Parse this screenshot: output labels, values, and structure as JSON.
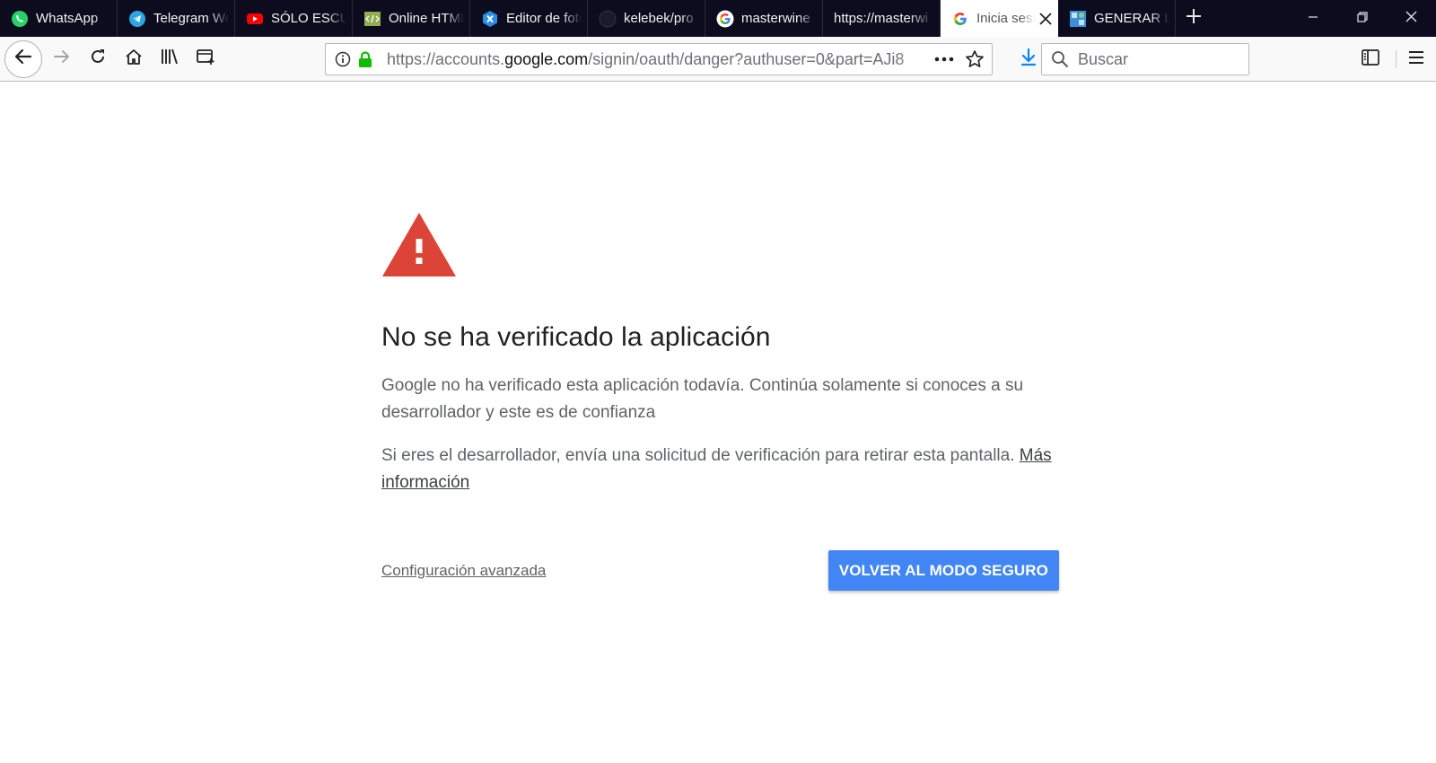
{
  "tabs": [
    {
      "label": "WhatsApp",
      "icon": "whatsapp-icon",
      "active": false
    },
    {
      "label": "Telegram Web",
      "icon": "telegram-icon",
      "active": false
    },
    {
      "label": "SÓLO ESCUCHA",
      "icon": "youtube-icon",
      "active": false
    },
    {
      "label": "Online HTML",
      "icon": "html-editor-icon",
      "active": false
    },
    {
      "label": "Editor de fotos",
      "icon": "photo-editor-icon",
      "active": false
    },
    {
      "label": "kelebek/pro",
      "icon": "github-icon",
      "active": false
    },
    {
      "label": "masterwine",
      "icon": "google-icon",
      "active": false
    },
    {
      "label": "https://masterwi",
      "icon": "",
      "active": false
    },
    {
      "label": "Inicia sesión",
      "icon": "google-icon",
      "active": true
    },
    {
      "label": "GENERAR LA",
      "icon": "generator-icon",
      "active": false
    }
  ],
  "url": {
    "prefix": "https://accounts.",
    "domain": "google.com",
    "path": "/signin/oauth/danger?authuser=0&part=AJi8"
  },
  "search": {
    "placeholder": "Buscar"
  },
  "page": {
    "title": "No se ha verificado la aplicación",
    "paragraph1": "Google no ha verificado esta aplicación todavía. Continúa solamente si conoces a su desarrollador y este es de confianza",
    "paragraph2": "Si eres el desarrollador, envía una solicitud de verificación para retirar esta pantalla.",
    "more_info_link": "Más información",
    "advanced_link": "Configuración avanzada",
    "safe_button": "VOLVER AL MODO SEGURO"
  },
  "colors": {
    "tabstrip": "#0c0c1e",
    "primary_button": "#4285f4",
    "warning": "#db4437",
    "secure_lock": "#12bc00",
    "download_arrow": "#0a84ff"
  }
}
